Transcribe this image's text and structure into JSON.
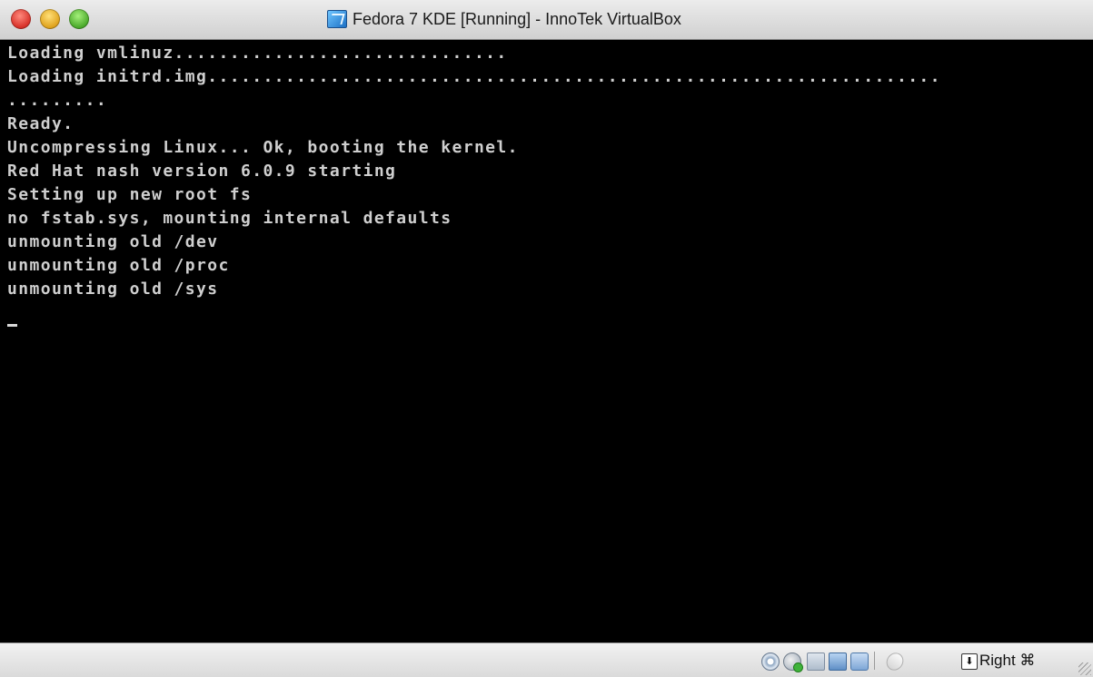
{
  "window": {
    "title": "Fedora 7 KDE [Running] - InnoTek VirtualBox"
  },
  "console": {
    "lines": [
      "Loading vmlinuz..............................",
      "Loading initrd.img..................................................................",
      ".........",
      "Ready.",
      "Uncompressing Linux... Ok, booting the kernel.",
      "Red Hat nash version 6.0.9 starting",
      "Setting up new root fs",
      "no fstab.sys, mounting internal defaults",
      "unmounting old /dev",
      "unmounting old /proc",
      "unmounting old /sys"
    ],
    "text_color": "#cfcfcf",
    "background": "#000000"
  },
  "statusbar": {
    "icons": [
      "hard-disk-icon",
      "cd-dvd-icon",
      "floppy-icon",
      "network-icon",
      "shared-folders-icon",
      "mouse-integration-icon",
      "keyboard-capture-icon"
    ],
    "host_key_label": "Right ⌘"
  }
}
